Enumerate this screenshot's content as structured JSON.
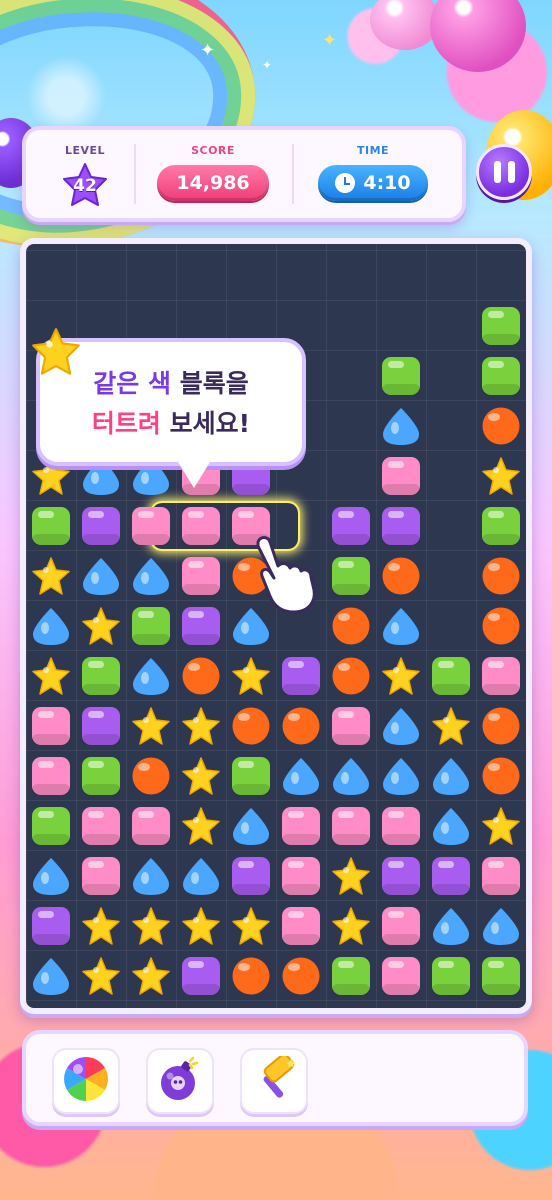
{
  "header": {
    "level_label": "LEVEL",
    "level_value": "42",
    "score_label": "SCORE",
    "score_value": "14,986",
    "time_label": "TIME",
    "time_value": "4:10"
  },
  "tooltip": {
    "line1_a": "같은 색",
    "line1_b": "블록을",
    "line2_a": "터트려",
    "line2_b": "보세요!"
  },
  "colors": {
    "G": "#79d13d",
    "P": "#ff8cc6",
    "V": "#a85cf0",
    "B": "#4aa6ff",
    "O": "#ff6a1a",
    "S": "#ffd21f"
  },
  "grid": [
    "..........",
    ".........G",
    ".......G.G",
    ".V..V..B.O",
    "SBBPV..P.S",
    "GVPPP.VV.G",
    "SBBPO.GO.O",
    "BSGVB.OB.O",
    "SGBOSVOSGP",
    "PVSSOOPBSO",
    "PGOSGBBBBO",
    "GPPSBPPPBS",
    "BPBBVPSVVP",
    "VSSSSPSPBB",
    "BSSVOOGPGG"
  ],
  "boosters": [
    "rainbow-ball-icon",
    "bomb-icon",
    "hammer-icon"
  ]
}
